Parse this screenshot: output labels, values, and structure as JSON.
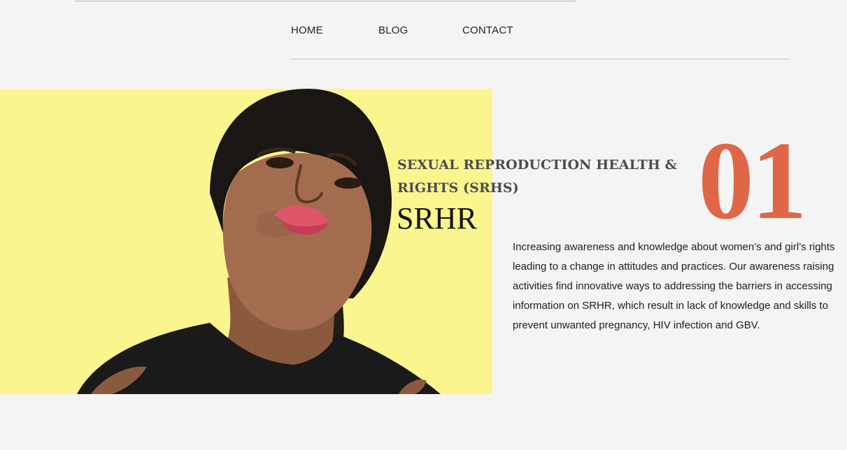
{
  "nav": {
    "home_label": "HOME",
    "blog_label": "BLOG",
    "contact_label": "CONTACT"
  },
  "feature": {
    "kicker": "SEXUAL REPRODUCTION HEALTH & RIGHTS (SRHS)",
    "title": "SRHR",
    "number": "01",
    "body": "Increasing awareness and knowledge about women’s and girl’s rights leading to a change in attitudes and practices. Our awareness raising activities find innovative ways to addressing the barriers in accessing information on SRHR, which result in lack of knowledge and skills to prevent unwanted pregnancy, HIV infection and GBV."
  },
  "colors": {
    "page_background": "#f4f4f4",
    "accent_number": "#df6747",
    "photo_background": "#fbf48a",
    "kicker_text": "#4d4d4d"
  }
}
